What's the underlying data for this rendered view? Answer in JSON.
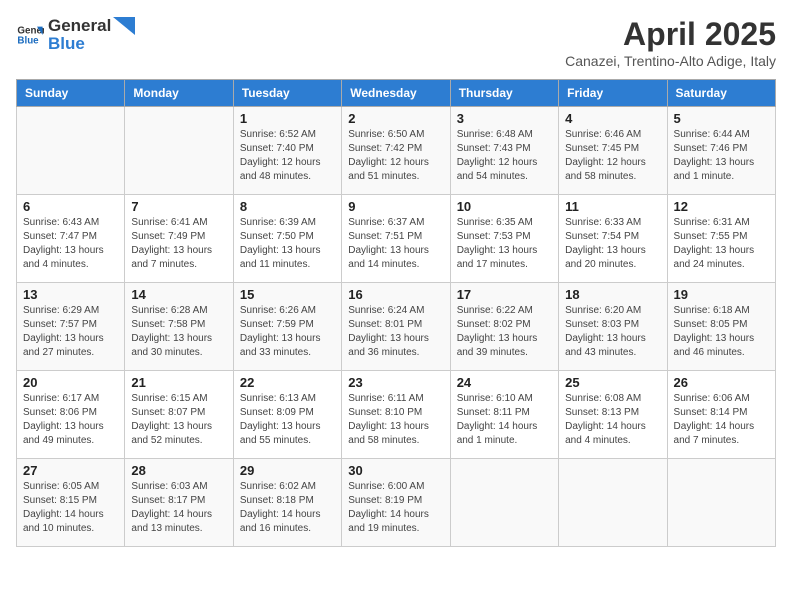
{
  "header": {
    "logo_line1": "General",
    "logo_line2": "Blue",
    "month": "April 2025",
    "location": "Canazei, Trentino-Alto Adige, Italy"
  },
  "days_of_week": [
    "Sunday",
    "Monday",
    "Tuesday",
    "Wednesday",
    "Thursday",
    "Friday",
    "Saturday"
  ],
  "weeks": [
    [
      {
        "day": "",
        "info": ""
      },
      {
        "day": "",
        "info": ""
      },
      {
        "day": "1",
        "info": "Sunrise: 6:52 AM\nSunset: 7:40 PM\nDaylight: 12 hours and 48 minutes."
      },
      {
        "day": "2",
        "info": "Sunrise: 6:50 AM\nSunset: 7:42 PM\nDaylight: 12 hours and 51 minutes."
      },
      {
        "day": "3",
        "info": "Sunrise: 6:48 AM\nSunset: 7:43 PM\nDaylight: 12 hours and 54 minutes."
      },
      {
        "day": "4",
        "info": "Sunrise: 6:46 AM\nSunset: 7:45 PM\nDaylight: 12 hours and 58 minutes."
      },
      {
        "day": "5",
        "info": "Sunrise: 6:44 AM\nSunset: 7:46 PM\nDaylight: 13 hours and 1 minute."
      }
    ],
    [
      {
        "day": "6",
        "info": "Sunrise: 6:43 AM\nSunset: 7:47 PM\nDaylight: 13 hours and 4 minutes."
      },
      {
        "day": "7",
        "info": "Sunrise: 6:41 AM\nSunset: 7:49 PM\nDaylight: 13 hours and 7 minutes."
      },
      {
        "day": "8",
        "info": "Sunrise: 6:39 AM\nSunset: 7:50 PM\nDaylight: 13 hours and 11 minutes."
      },
      {
        "day": "9",
        "info": "Sunrise: 6:37 AM\nSunset: 7:51 PM\nDaylight: 13 hours and 14 minutes."
      },
      {
        "day": "10",
        "info": "Sunrise: 6:35 AM\nSunset: 7:53 PM\nDaylight: 13 hours and 17 minutes."
      },
      {
        "day": "11",
        "info": "Sunrise: 6:33 AM\nSunset: 7:54 PM\nDaylight: 13 hours and 20 minutes."
      },
      {
        "day": "12",
        "info": "Sunrise: 6:31 AM\nSunset: 7:55 PM\nDaylight: 13 hours and 24 minutes."
      }
    ],
    [
      {
        "day": "13",
        "info": "Sunrise: 6:29 AM\nSunset: 7:57 PM\nDaylight: 13 hours and 27 minutes."
      },
      {
        "day": "14",
        "info": "Sunrise: 6:28 AM\nSunset: 7:58 PM\nDaylight: 13 hours and 30 minutes."
      },
      {
        "day": "15",
        "info": "Sunrise: 6:26 AM\nSunset: 7:59 PM\nDaylight: 13 hours and 33 minutes."
      },
      {
        "day": "16",
        "info": "Sunrise: 6:24 AM\nSunset: 8:01 PM\nDaylight: 13 hours and 36 minutes."
      },
      {
        "day": "17",
        "info": "Sunrise: 6:22 AM\nSunset: 8:02 PM\nDaylight: 13 hours and 39 minutes."
      },
      {
        "day": "18",
        "info": "Sunrise: 6:20 AM\nSunset: 8:03 PM\nDaylight: 13 hours and 43 minutes."
      },
      {
        "day": "19",
        "info": "Sunrise: 6:18 AM\nSunset: 8:05 PM\nDaylight: 13 hours and 46 minutes."
      }
    ],
    [
      {
        "day": "20",
        "info": "Sunrise: 6:17 AM\nSunset: 8:06 PM\nDaylight: 13 hours and 49 minutes."
      },
      {
        "day": "21",
        "info": "Sunrise: 6:15 AM\nSunset: 8:07 PM\nDaylight: 13 hours and 52 minutes."
      },
      {
        "day": "22",
        "info": "Sunrise: 6:13 AM\nSunset: 8:09 PM\nDaylight: 13 hours and 55 minutes."
      },
      {
        "day": "23",
        "info": "Sunrise: 6:11 AM\nSunset: 8:10 PM\nDaylight: 13 hours and 58 minutes."
      },
      {
        "day": "24",
        "info": "Sunrise: 6:10 AM\nSunset: 8:11 PM\nDaylight: 14 hours and 1 minute."
      },
      {
        "day": "25",
        "info": "Sunrise: 6:08 AM\nSunset: 8:13 PM\nDaylight: 14 hours and 4 minutes."
      },
      {
        "day": "26",
        "info": "Sunrise: 6:06 AM\nSunset: 8:14 PM\nDaylight: 14 hours and 7 minutes."
      }
    ],
    [
      {
        "day": "27",
        "info": "Sunrise: 6:05 AM\nSunset: 8:15 PM\nDaylight: 14 hours and 10 minutes."
      },
      {
        "day": "28",
        "info": "Sunrise: 6:03 AM\nSunset: 8:17 PM\nDaylight: 14 hours and 13 minutes."
      },
      {
        "day": "29",
        "info": "Sunrise: 6:02 AM\nSunset: 8:18 PM\nDaylight: 14 hours and 16 minutes."
      },
      {
        "day": "30",
        "info": "Sunrise: 6:00 AM\nSunset: 8:19 PM\nDaylight: 14 hours and 19 minutes."
      },
      {
        "day": "",
        "info": ""
      },
      {
        "day": "",
        "info": ""
      },
      {
        "day": "",
        "info": ""
      }
    ]
  ]
}
